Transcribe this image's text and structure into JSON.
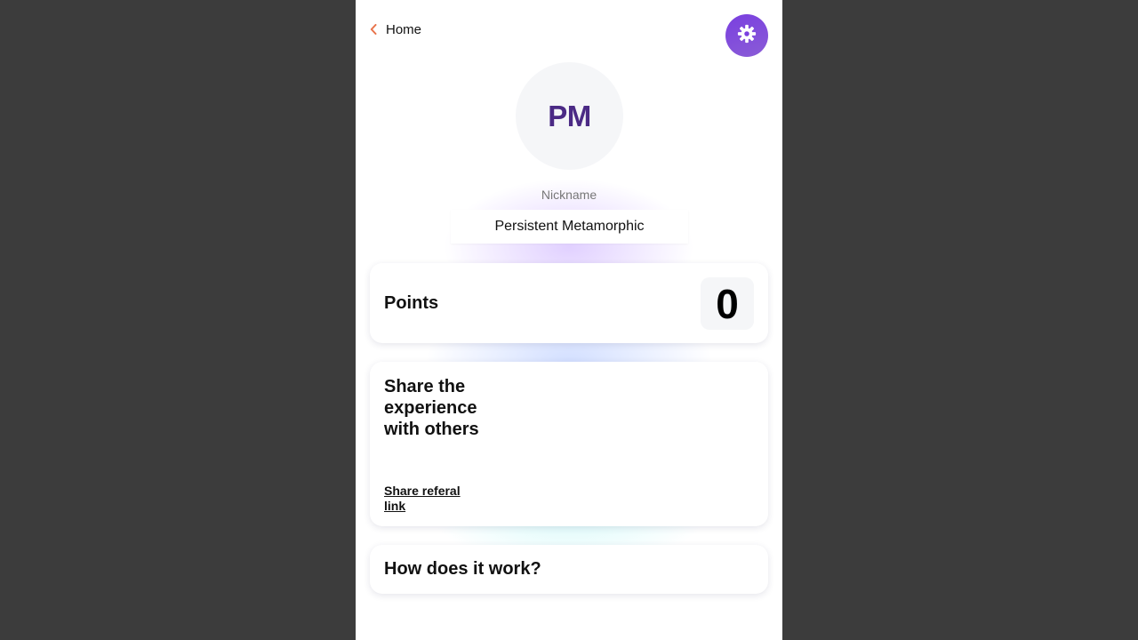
{
  "header": {
    "back_label": "Home",
    "accent_color": "#e8734a",
    "settings_color": "#7a3fe0"
  },
  "profile": {
    "initials": "PM",
    "nickname_label": "Nickname",
    "nickname_value": "Persistent Metamorphic"
  },
  "points": {
    "title": "Points",
    "value": "0"
  },
  "share": {
    "title": "Share the experience with others",
    "link_label": "Share referal link"
  },
  "how": {
    "title": "How does it work?"
  },
  "icons": {
    "back": "chevron-left-icon",
    "settings": "gear-icon"
  }
}
